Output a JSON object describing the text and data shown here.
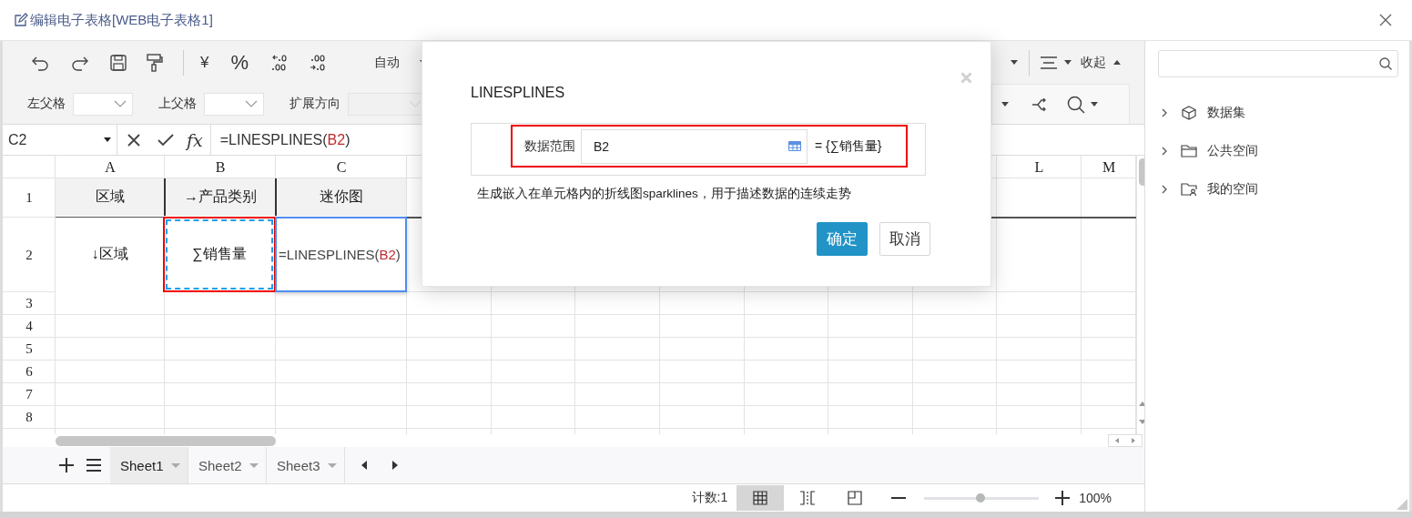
{
  "window": {
    "title": "编辑电子表格[WEB电子表格1]"
  },
  "toolbar": {
    "currency": "¥",
    "percent": "%",
    "number_format": "自动",
    "collapse": "收起",
    "parent_selects": [
      {
        "label": "左父格",
        "disabled": false
      },
      {
        "label": "上父格",
        "disabled": false
      },
      {
        "label": "扩展方向",
        "disabled": true
      }
    ]
  },
  "formula_bar": {
    "cell_ref": "C2",
    "fx": "fx",
    "formula": [
      {
        "text": "=LINESPLINES(",
        "kind": "plain"
      },
      {
        "text": "B2",
        "kind": "ref"
      },
      {
        "text": ")",
        "kind": "plain"
      }
    ]
  },
  "grid": {
    "column_headers": [
      "A",
      "B",
      "C",
      "L",
      "M"
    ],
    "rows": [
      {
        "header": "1",
        "cells": [
          {
            "kind": "title",
            "text": "区域",
            "selected": false,
            "referenced": false,
            "spans_next_row": false
          },
          {
            "kind": "title",
            "text": "→产品类别",
            "selected": false,
            "referenced": false,
            "spans_next_row": false
          },
          {
            "kind": "title",
            "text": "迷你图",
            "selected": false,
            "referenced": false,
            "spans_next_row": false
          }
        ]
      },
      {
        "header": "2",
        "cells": [
          {
            "kind": "text",
            "text": "↓区域",
            "selected": false,
            "referenced": false,
            "spans_next_row": true
          },
          {
            "kind": "text",
            "text": "∑销售量",
            "selected": false,
            "referenced": true,
            "spans_next_row": false
          },
          {
            "kind": "formula",
            "parts": [
              {
                "text": "=LINESPLINES(",
                "kind": "plain"
              },
              {
                "text": "B2",
                "kind": "ref"
              },
              {
                "text": ")",
                "kind": "plain"
              }
            ],
            "selected": true,
            "referenced": false,
            "spans_next_row": false
          }
        ]
      },
      {
        "header": "3"
      },
      {
        "header": "4"
      },
      {
        "header": "5"
      },
      {
        "header": "6"
      },
      {
        "header": "7"
      },
      {
        "header": "8"
      }
    ]
  },
  "sheets": [
    {
      "label": "Sheet1",
      "selected": true
    },
    {
      "label": "Sheet2",
      "selected": false
    },
    {
      "label": "Sheet3",
      "selected": false
    }
  ],
  "status_bar": {
    "count": "计数:1",
    "views": [
      {
        "kind": "normal",
        "selected": true
      },
      {
        "kind": "page-break",
        "selected": false
      },
      {
        "kind": "page-layout",
        "selected": false
      }
    ],
    "zoom": {
      "level": 0.49,
      "reading": "100%"
    }
  },
  "dialog": {
    "title": "LINESPLINES",
    "field_label": "数据范围",
    "field_value": "B2",
    "resolved": "= {∑销售量}",
    "description": "生成嵌入在单元格内的折线图sparklines，用于描述数据的连续走势",
    "buttons": [
      {
        "label": "确定",
        "kind": "primary"
      },
      {
        "label": "取消",
        "kind": "secondary"
      }
    ]
  },
  "tree": [
    {
      "label": "数据集",
      "kind": "dataset",
      "expanded": false
    },
    {
      "label": "公共空间",
      "kind": "folder",
      "expanded": false
    },
    {
      "label": "我的空间",
      "kind": "user-folder",
      "expanded": false
    }
  ]
}
